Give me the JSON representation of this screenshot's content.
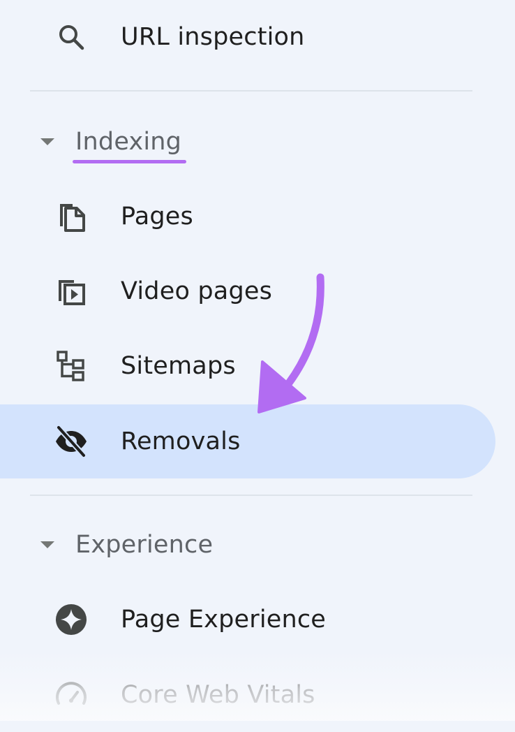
{
  "nav": {
    "url_inspection": {
      "label": "URL inspection",
      "icon": "search-icon"
    },
    "indexing": {
      "label": "Indexing",
      "underline_color": "#b26cf2",
      "items": [
        {
          "label": "Pages",
          "icon": "pages-icon"
        },
        {
          "label": "Video pages",
          "icon": "video-pages-icon"
        },
        {
          "label": "Sitemaps",
          "icon": "sitemaps-icon"
        },
        {
          "label": "Removals",
          "icon": "eye-off-icon",
          "selected": true
        }
      ]
    },
    "experience": {
      "label": "Experience",
      "items": [
        {
          "label": "Page Experience",
          "icon": "page-experience-icon"
        },
        {
          "label": "Core Web Vitals",
          "icon": "speedometer-icon"
        }
      ]
    }
  },
  "colors": {
    "background": "#f0f4fb",
    "selected_background": "#d3e3fd",
    "text": "#1f1f1f",
    "section_text": "#5f6368",
    "icon": "#444746",
    "annotation_arrow": "#b26cf2"
  }
}
